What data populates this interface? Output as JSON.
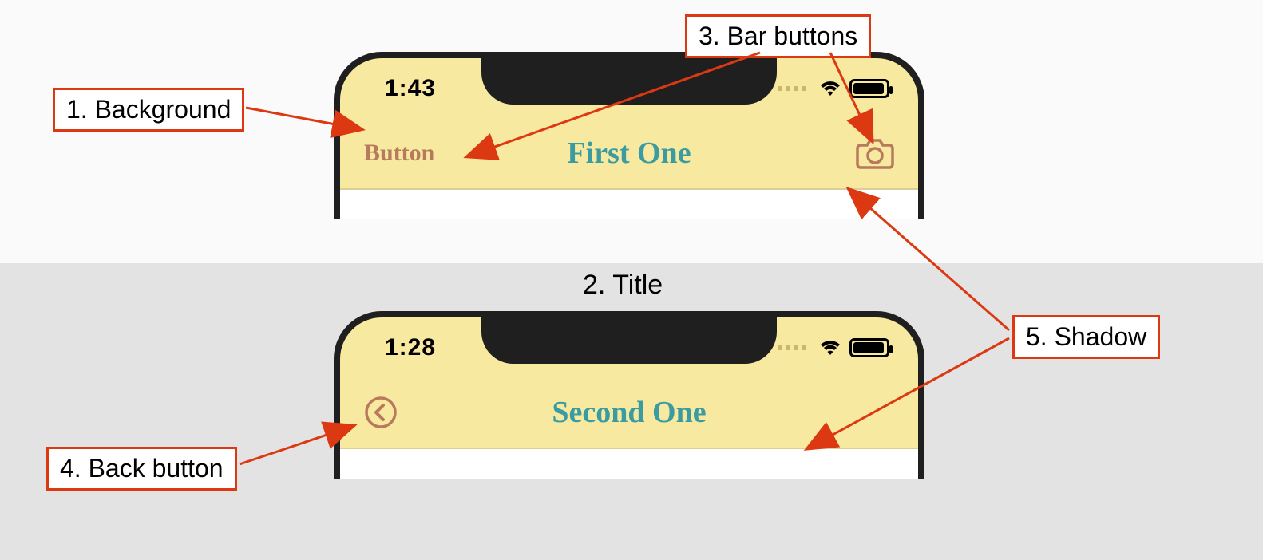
{
  "callouts": {
    "background": "1. Background",
    "title": "2. Title",
    "barButtons": "3. Bar buttons",
    "backButton": "4. Back button",
    "shadow": "5. Shadow"
  },
  "phone1": {
    "time": "1:43",
    "leftButton": "Button",
    "title": "First One"
  },
  "phone2": {
    "time": "1:28",
    "title": "Second One"
  },
  "colors": {
    "navBg": "#f8e9a0",
    "titleColor": "#3a9ca0",
    "buttonColor": "#b87a5d",
    "calloutBorder": "#dc3912"
  }
}
